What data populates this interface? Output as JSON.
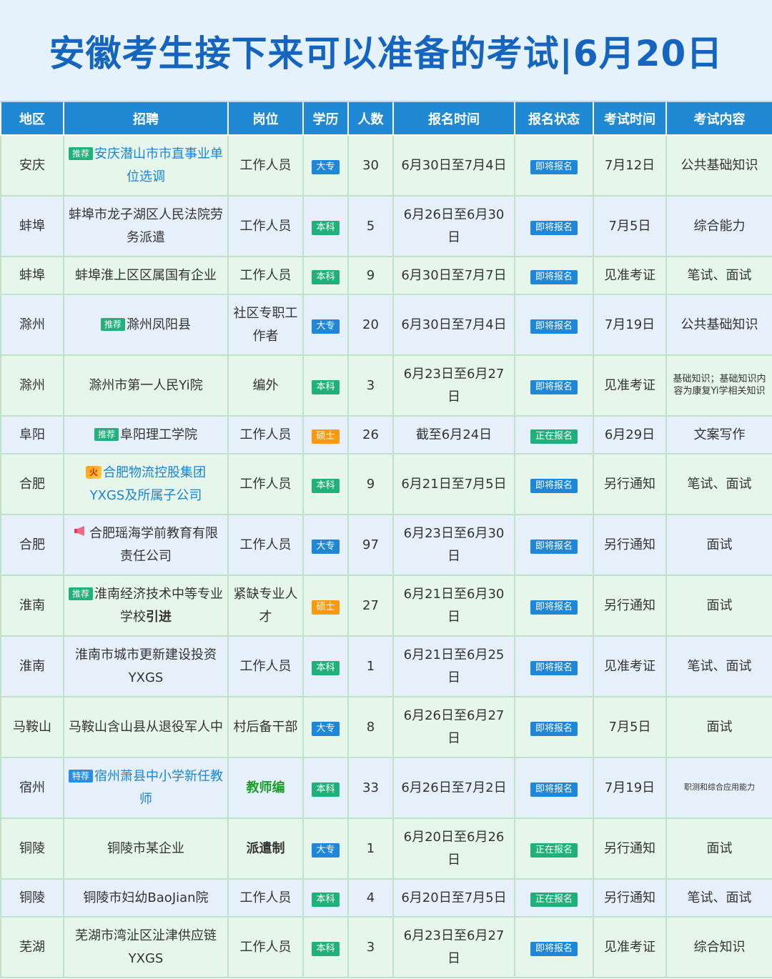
{
  "title": "安徽考生接下来可以准备的考试|6月20日",
  "headers": [
    "地区",
    "招聘",
    "岗位",
    "学历",
    "人数",
    "报名时间",
    "报名状态",
    "考试时间",
    "考试内容"
  ],
  "rows": [
    {
      "region": "安庆",
      "tag": "推荐",
      "recruit": "安庆潜山市市直事业单位选调",
      "position": "工作人员",
      "edu": "大专",
      "count": "30",
      "reg_time": "6月30日至7月4日",
      "status": "即将报名",
      "exam_time": "7月12日",
      "content": "公共基础知识"
    },
    {
      "region": "蚌埠",
      "recruit": "蚌埠市龙子湖区人民法院劳务派遣",
      "position": "工作人员",
      "edu": "本科",
      "count": "5",
      "reg_time": "6月26日至6月30日",
      "status": "即将报名",
      "exam_time": "7月5日",
      "content": "综合能力"
    },
    {
      "region": "蚌埠",
      "recruit": "蚌埠淮上区区属国有企业",
      "position": "工作人员",
      "edu": "本科",
      "count": "9",
      "reg_time": "6月30日至7月7日",
      "status": "即将报名",
      "exam_time": "见准考证",
      "content": "笔试、面试"
    },
    {
      "region": "滁州",
      "tag": "推荐",
      "recruit": "滁州凤阳县",
      "position": "社区专职工作者",
      "edu": "大专",
      "count": "20",
      "reg_time": "6月30日至7月4日",
      "status": "即将报名",
      "exam_time": "7月19日",
      "content": "公共基础知识"
    },
    {
      "region": "滁州",
      "recruit": "滁州市第一人民Yi院",
      "position": "编外",
      "edu": "本科",
      "count": "3",
      "reg_time": "6月23日至6月27日",
      "status": "即将报名",
      "exam_time": "见准考证",
      "content": "基础知识；基础知识内容为康复Yi学相关知识"
    },
    {
      "region": "阜阳",
      "tag": "推荐",
      "recruit": "阜阳理工学院",
      "position": "工作人员",
      "edu": "硕士",
      "count": "26",
      "reg_time": "截至6月24日",
      "status": "正在报名",
      "exam_time": "6月29日",
      "content": "文案写作"
    },
    {
      "region": "合肥",
      "tag": "火",
      "recruit": "合肥物流控股集团YXGS及所属子公司",
      "position": "工作人员",
      "edu": "本科",
      "count": "9",
      "reg_time": "6月21日至7月5日",
      "status": "即将报名",
      "exam_time": "另行通知",
      "content": "笔试、面试"
    },
    {
      "region": "合肥",
      "recruit": "合肥瑶海学前教育有限责任公司",
      "position": "工作人员",
      "edu": "大专",
      "count": "97",
      "reg_time": "6月23日至6月30日",
      "status": "即将报名",
      "exam_time": "另行通知",
      "content": "面试"
    },
    {
      "region": "淮南",
      "tag": "推荐",
      "recruit": "淮南经济技术中等专业学校",
      "recruit_bold": "引进",
      "position": "紧缺专业人才",
      "edu": "硕士",
      "count": "27",
      "reg_time": "6月21日至6月30日",
      "status": "即将报名",
      "exam_time": "另行通知",
      "content": "面试"
    },
    {
      "region": "淮南",
      "recruit": "淮南市城市更新建设投资YXGS",
      "position": "工作人员",
      "edu": "本科",
      "count": "1",
      "reg_time": "6月21日至6月25日",
      "status": "即将报名",
      "exam_time": "见准考证",
      "content": "笔试、面试"
    },
    {
      "region": "马鞍山",
      "recruit": "马鞍山含山县从退役军人中",
      "position": "村后备干部",
      "edu": "大专",
      "count": "8",
      "reg_time": "6月26日至6月27日",
      "status": "即将报名",
      "exam_time": "7月5日",
      "content": "面试"
    },
    {
      "region": "宿州",
      "tag": "特荐",
      "recruit": "宿州萧县中小学新任教师",
      "position": "教师编",
      "edu": "本科",
      "count": "33",
      "reg_time": "6月26日至7月2日",
      "status": "即将报名",
      "exam_time": "7月19日",
      "content": "职测和综合应用能力"
    },
    {
      "region": "铜陵",
      "recruit": "铜陵市某企业",
      "position": "派遣制",
      "edu": "大专",
      "count": "1",
      "reg_time": "6月20日至6月26日",
      "status": "正在报名",
      "exam_time": "另行通知",
      "content": "面试"
    },
    {
      "region": "铜陵",
      "recruit": "铜陵市妇幼BaoJian院",
      "position": "工作人员",
      "edu": "本科",
      "count": "4",
      "reg_time": "6月20日至7月5日",
      "status": "正在报名",
      "exam_time": "另行通知",
      "content": "笔试、面试"
    },
    {
      "region": "芜湖",
      "recruit": "芜湖市湾沚区沚津供应链YXGS",
      "position": "工作人员",
      "edu": "本科",
      "count": "3",
      "reg_time": "6月23日至6月27日",
      "status": "即将报名",
      "exam_time": "见准考证",
      "content": "综合知识"
    }
  ]
}
